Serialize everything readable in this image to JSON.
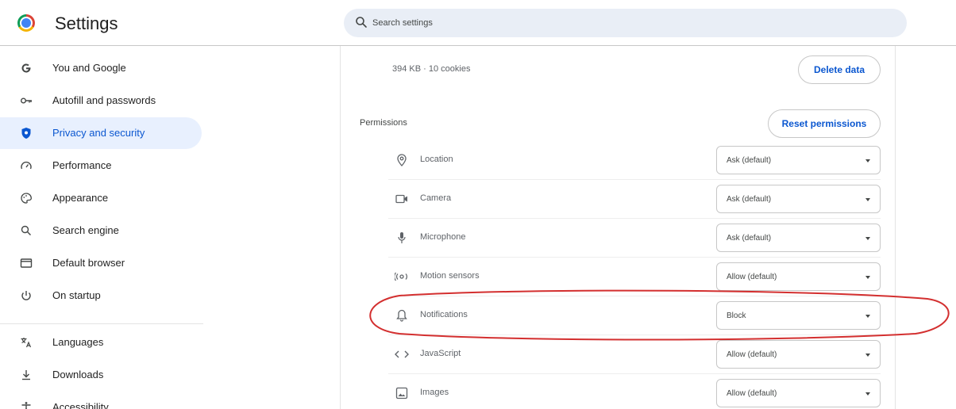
{
  "header": {
    "title": "Settings",
    "search_placeholder": "Search settings"
  },
  "sidebar": {
    "items": [
      {
        "label": "You and Google",
        "icon": "google-g-icon"
      },
      {
        "label": "Autofill and passwords",
        "icon": "key-icon"
      },
      {
        "label": "Privacy and security",
        "icon": "shield-icon",
        "active": true
      },
      {
        "label": "Performance",
        "icon": "speedometer-icon"
      },
      {
        "label": "Appearance",
        "icon": "palette-icon"
      },
      {
        "label": "Search engine",
        "icon": "search-icon"
      },
      {
        "label": "Default browser",
        "icon": "browser-window-icon"
      },
      {
        "label": "On startup",
        "icon": "power-icon"
      },
      {
        "label": "Languages",
        "icon": "translate-icon"
      },
      {
        "label": "Downloads",
        "icon": "download-icon"
      },
      {
        "label": "Accessibility",
        "icon": "accessibility-icon"
      }
    ]
  },
  "main": {
    "storage_text": "394 KB · 10 cookies",
    "delete_button": "Delete data",
    "permissions_heading": "Permissions",
    "reset_button": "Reset permissions",
    "permissions": [
      {
        "label": "Location",
        "icon": "location-pin-icon",
        "value": "Ask (default)"
      },
      {
        "label": "Camera",
        "icon": "camera-icon",
        "value": "Ask (default)"
      },
      {
        "label": "Microphone",
        "icon": "microphone-icon",
        "value": "Ask (default)"
      },
      {
        "label": "Motion sensors",
        "icon": "motion-sensor-icon",
        "value": "Allow (default)"
      },
      {
        "label": "Notifications",
        "icon": "bell-icon",
        "value": "Block",
        "highlighted": true
      },
      {
        "label": "JavaScript",
        "icon": "code-icon",
        "value": "Allow (default)"
      },
      {
        "label": "Images",
        "icon": "image-icon",
        "value": "Allow (default)"
      }
    ]
  },
  "colors": {
    "accent": "#0b57d0",
    "active_bg": "#e8f0fe",
    "search_bg": "#e9eef6",
    "annotation": "#d32f2f"
  }
}
